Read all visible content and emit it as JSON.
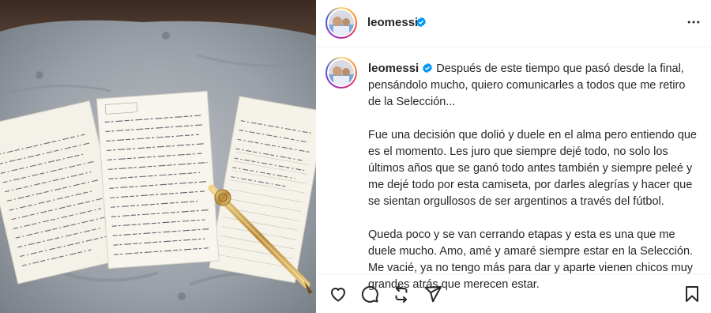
{
  "post": {
    "username": "leomessi",
    "verified": true,
    "more_icon": "more-horizontal-icon"
  },
  "caption": {
    "username": "leomessi",
    "paragraphs": [
      "Después de este tiempo que pasó desde la final, pensándolo mucho, quiero comunicarles a todos que me retiro de la Selección...",
      "Fue una decisión que dolió y duele en el alma pero entiendo que es el momento. Les juro que siempre dejé todo, no solo los últimos años que se ganó todo antes también y siempre peleé y me dejé todo por esta camiseta, por darles alegrías y hacer que se sientan orgullosos de ser argentinos a través del fútbol.",
      "Queda poco y se van cerrando etapas y esta es una que me duele mucho. Amo, amé y amaré siempre estar en la Selección. Me vacié, ya no tengo más para dar y aparte vienen chicos muy grandes atrás que merecen estar."
    ]
  },
  "actions": {
    "icons": [
      "heart-icon",
      "comment-icon",
      "repost-icon",
      "share-icon",
      "bookmark-icon"
    ]
  },
  "colors": {
    "text": "#262626",
    "verified": "#0095f6",
    "border": "#efefef"
  }
}
